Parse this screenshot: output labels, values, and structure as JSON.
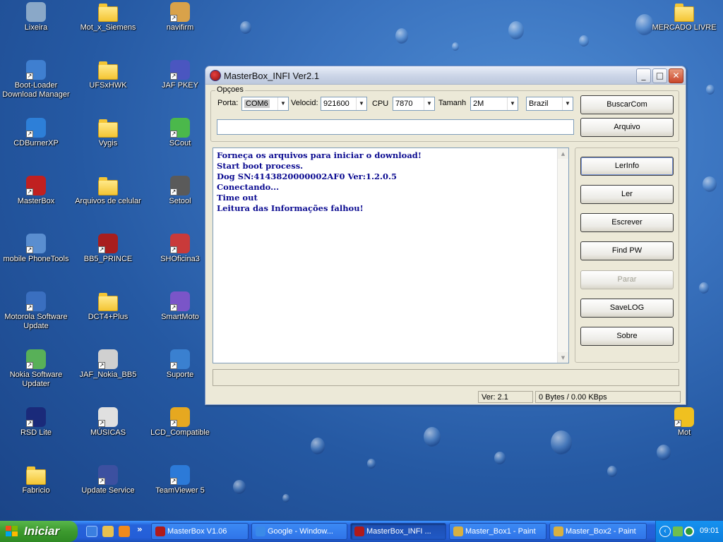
{
  "desktop": {
    "icons": [
      {
        "label": "Lixeira",
        "icon": "recycle-bin-icon"
      },
      {
        "label": "Mot_x_Siemens",
        "icon": "folder-icon"
      },
      {
        "label": "navifirm",
        "icon": "phone-app-icon"
      },
      {
        "label": "MERCADO LIVRE",
        "icon": "folder-icon"
      },
      {
        "label": "Boot-Loader Download Manager",
        "icon": "bootloader-icon"
      },
      {
        "label": "UFSxHWK",
        "icon": "folder-icon"
      },
      {
        "label": "JAF PKEY",
        "icon": "jaf-pkey-icon"
      },
      {
        "label": "CDBurnerXP",
        "icon": "cd-burner-icon"
      },
      {
        "label": "Vygis",
        "icon": "folder-icon"
      },
      {
        "label": "SCout",
        "icon": "scout-icon"
      },
      {
        "label": "MasterBox",
        "icon": "masterbox-icon"
      },
      {
        "label": "Arquivos de celular",
        "icon": "folder-icon"
      },
      {
        "label": "Setool",
        "icon": "setool-icon"
      },
      {
        "label": "mobile PhoneTools",
        "icon": "phonetools-icon"
      },
      {
        "label": "BB5_PRINCE",
        "icon": "bb5-prince-icon"
      },
      {
        "label": "SHOficina3",
        "icon": "shoficina-icon"
      },
      {
        "label": "Motorola Software Update",
        "icon": "motorola-update-icon"
      },
      {
        "label": "DCT4+Plus",
        "icon": "folder-icon"
      },
      {
        "label": "SmartMoto",
        "icon": "smartmoto-icon"
      },
      {
        "label": "Nokia Software Updater",
        "icon": "nokia-updater-icon"
      },
      {
        "label": "JAF_Nokia_BB5",
        "icon": "jaf-nokia-icon"
      },
      {
        "label": "Suporte",
        "icon": "suporte-icon"
      },
      {
        "label": "RSD Lite",
        "icon": "rsd-lite-icon"
      },
      {
        "label": "MÚSICAS",
        "icon": "musicas-icon"
      },
      {
        "label": "LCD_Compatible",
        "icon": "lcd-compatible-icon"
      },
      {
        "label": "Mot",
        "icon": "mot-icon"
      },
      {
        "label": "Fabricio",
        "icon": "folder-icon"
      },
      {
        "label": "Update Service",
        "icon": "update-service-icon"
      },
      {
        "label": "TeamViewer 5",
        "icon": "teamviewer-icon"
      }
    ]
  },
  "window": {
    "title": "MasterBox_INFI Ver2.1",
    "options_group": "Opçoes",
    "porta_label": "Porta:",
    "porta_value": "COM6",
    "velocidade_label": "Velocid:",
    "velocidade_value": "921600",
    "cpu_label": "CPU",
    "cpu_value": "7870",
    "tamanho_label": "Tamanh",
    "tamanho_value": "2M",
    "region_value": "Brazil",
    "path_value": "",
    "buttons": {
      "buscarcom": "BuscarCom",
      "arquivo": "Arquivo",
      "lerinfo": "LerInfo",
      "ler": "Ler",
      "escrever": "Escrever",
      "findpw": "Find PW",
      "parar": "Parar",
      "savelog": "SaveLOG",
      "sobre": "Sobre"
    },
    "log_lines": [
      "Forneça os arquivos para iniciar o download!",
      "Start boot process.",
      "Dog SN:4143820000002AF0 Ver:1.2.0.5",
      "Conectando...",
      "Time out",
      "Leitura das Informações falhou!"
    ],
    "status_version": "Ver: 2.1",
    "status_transfer": "0 Bytes / 0.00 KBps"
  },
  "taskbar": {
    "start_label": "Iniciar",
    "tasks": [
      {
        "label": "MasterBox V1.06",
        "active": false
      },
      {
        "label": "Google - Window...",
        "active": false
      },
      {
        "label": "MasterBox_INFI ...",
        "active": true
      },
      {
        "label": "Master_Box1 - Paint",
        "active": false
      },
      {
        "label": "Master_Box2 - Paint",
        "active": false
      }
    ],
    "clock": "09:01"
  }
}
